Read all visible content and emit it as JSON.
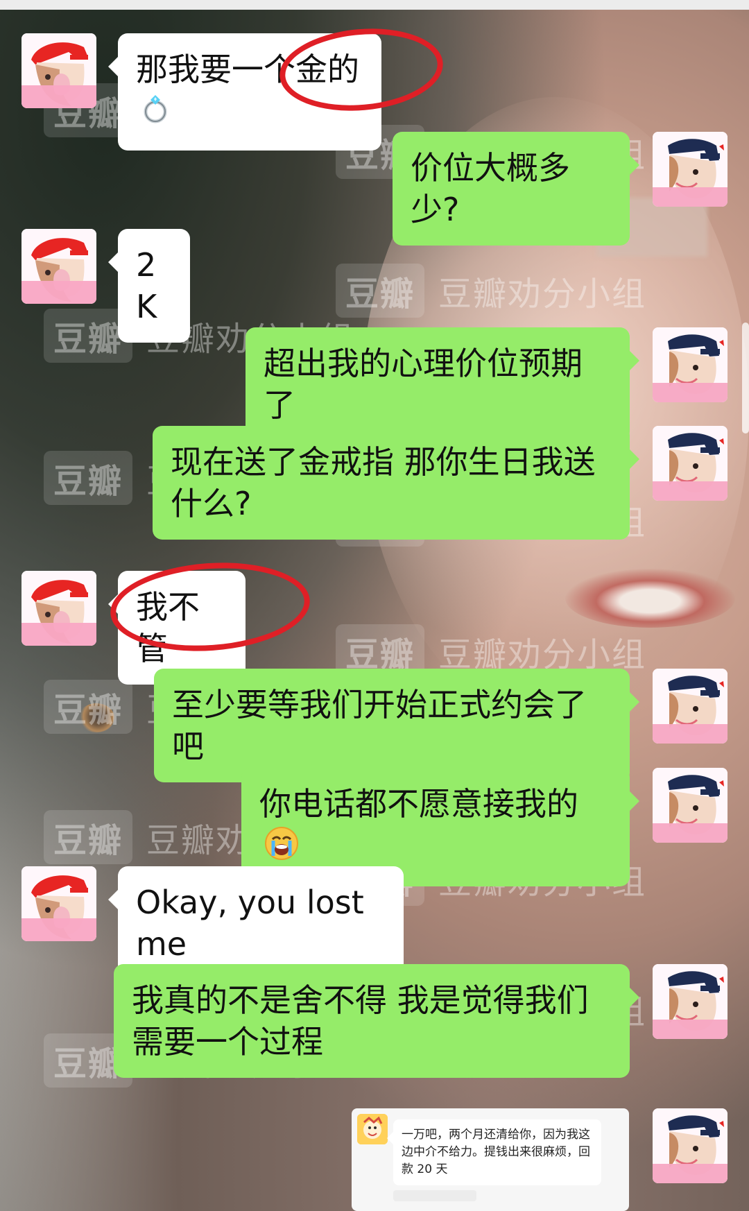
{
  "watermark": {
    "tag": "豆瓣",
    "text": "豆瓣劝分小组"
  },
  "messages": [
    {
      "side": "left",
      "text": "那我要一个金的",
      "emoji": "ring"
    },
    {
      "side": "right",
      "text": "价位大概多少?"
    },
    {
      "side": "left",
      "text": "2K"
    },
    {
      "side": "right",
      "text": "超出我的心理价位预期了"
    },
    {
      "side": "right",
      "text": "现在送了金戒指 那你生日我送什么?"
    },
    {
      "side": "left",
      "text": "我不管"
    },
    {
      "side": "right",
      "text": "至少要等我们开始正式约会了吧"
    },
    {
      "side": "right",
      "text": "你电话都不愿意接我的",
      "emoji": "crying-face"
    },
    {
      "side": "left",
      "text": "Okay, you lost me"
    },
    {
      "side": "right",
      "text": "我真的不是舍不得 我是觉得我们需要一个过程"
    }
  ],
  "quoted_message": {
    "text": "一万吧，两个月还清给你，因为我这边中介不给力。提钱出来很麻烦，回款 20 天"
  },
  "colors": {
    "my_bubble": "#95ec69",
    "their_bubble": "#ffffff",
    "annotation_circle": "#df1f26"
  },
  "icons": {
    "ring": "ring-icon",
    "cry": "crying-face-icon"
  }
}
